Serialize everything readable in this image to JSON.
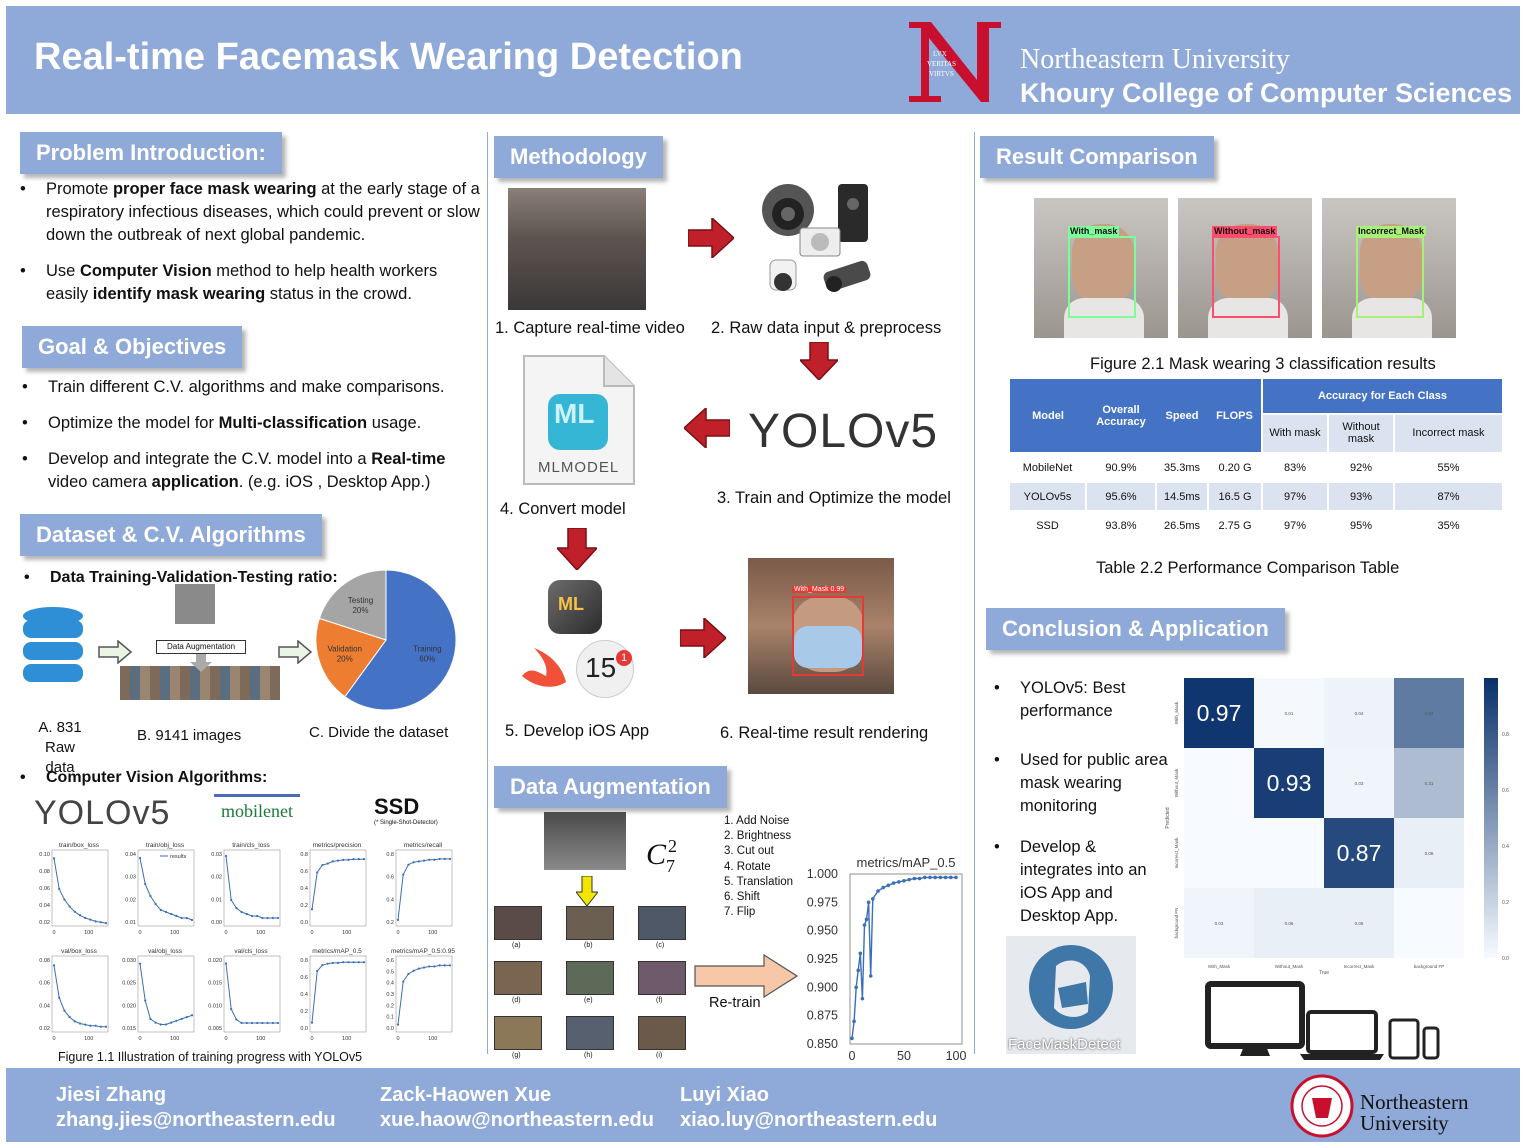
{
  "header": {
    "title": "Real-time Facemask Wearing Detection",
    "seal_text": "LVX VERITAS VIRTVS",
    "univ": "Northeastern University",
    "college": "Khoury College of Computer Sciences"
  },
  "problem": {
    "heading": "Problem Introduction:",
    "b1_pre": "Promote ",
    "b1_bold": "proper face mask wearing",
    "b1_post": " at the early stage of a respiratory infectious diseases, which could prevent or slow down the outbreak of next global pandemic.",
    "b2_pre": "Use ",
    "b2_bold": "Computer Vision",
    "b2_mid": " method to help health workers easily ",
    "b2_bold2": "identify mask wearing",
    "b2_post": " status in the crowd."
  },
  "goal": {
    "heading": "Goal & Objectives",
    "b1": "Train different C.V. algorithms and make comparisons.",
    "b2_pre": "Optimize the model for ",
    "b2_bold": "Multi-classification",
    "b2_post": " usage.",
    "b3_pre": "Develop and integrate the C.V. model into a ",
    "b3_bold": "Real-time",
    "b3_mid": " video camera ",
    "b3_bold2": "application",
    "b3_post": ". (e.g. iOS , Desktop App.)"
  },
  "dataset": {
    "heading": "Dataset & C.V. Algorithms",
    "ratio_label": "Data Training-Validation-Testing ratio:",
    "aug_label": "Data Augmentation",
    "a_label": "A. 831",
    "a_label2": "Raw data",
    "b_label": "B. 9141 images",
    "c_label": "C. Divide the dataset",
    "cv_label": "Computer Vision Algorithms:",
    "yolo": "YOLOv5",
    "mobilenet": "mobilenet",
    "ssd": "SSD",
    "ssd_note": "(* Single-Shot-Detector)",
    "fig_caption": "Figure 1.1 Illustration of training progress with YOLOv5",
    "legend_results": "results"
  },
  "pie": {
    "type": "pie",
    "slices": [
      {
        "label": "Training",
        "pct": "60%",
        "value": 60,
        "color": "#4472c4"
      },
      {
        "label": "Validation",
        "pct": "20%",
        "value": 20,
        "color": "#ed7d31"
      },
      {
        "label": "Testing",
        "pct": "20%",
        "value": 20,
        "color": "#a5a5a5"
      }
    ]
  },
  "methodology": {
    "heading": "Methodology",
    "s1": "1. Capture real-time video",
    "s2": "2. Raw data input & preprocess",
    "s3": "3. Train and Optimize the model",
    "s4": "4. Convert model",
    "s5": "5. Develop iOS App",
    "s6": "6. Real-time result rendering",
    "mlmodel": "MLMODEL",
    "ml_icon": "ML",
    "yolo_logo": "YOLOv5",
    "ios_version": "15",
    "badge": "1",
    "det_label": "With_Mask 0.99"
  },
  "augmentation": {
    "heading": "Data Augmentation",
    "combo_base": "C",
    "combo_sup": "2",
    "combo_sub": "7",
    "list": [
      "1. Add Noise",
      "2. Brightness",
      "3. Cut out",
      "4. Rotate",
      "5. Translation",
      "6. Shift",
      "7. Flip"
    ],
    "retrain": "Re-train",
    "tile_labels": [
      "(a)",
      "(b)",
      "(c)",
      "(d)",
      "(e)",
      "(f)",
      "(g)",
      "(h)",
      "(i)"
    ]
  },
  "map_chart": {
    "type": "line",
    "title": "metrics/mAP_0.5",
    "xlim": [
      0,
      100
    ],
    "ylim": [
      0.85,
      1.0
    ],
    "yticks": [
      "1.000",
      "0.975",
      "0.950",
      "0.925",
      "0.900",
      "0.875",
      "0.850"
    ],
    "xticks": [
      "0",
      "50",
      "100"
    ],
    "x": [
      0,
      2,
      4,
      6,
      8,
      10,
      12,
      14,
      16,
      18,
      20,
      25,
      30,
      35,
      40,
      45,
      50,
      55,
      60,
      65,
      70,
      75,
      80,
      85,
      90,
      95,
      100
    ],
    "y": [
      0.855,
      0.87,
      0.9,
      0.915,
      0.93,
      0.89,
      0.955,
      0.96,
      0.975,
      0.91,
      0.978,
      0.985,
      0.988,
      0.99,
      0.992,
      0.993,
      0.994,
      0.995,
      0.996,
      0.996,
      0.997,
      0.997,
      0.997,
      0.997,
      0.997,
      0.997,
      0.997
    ]
  },
  "mini_charts": [
    {
      "title": "train/box_loss",
      "yticks": [
        "0.10",
        "0.08",
        "0.06",
        "0.04",
        "0.02"
      ],
      "ymax": 0.1,
      "ymin": 0.02,
      "values": [
        0.095,
        0.06,
        0.048,
        0.04,
        0.034,
        0.03,
        0.027,
        0.025,
        0.023,
        0.022,
        0.021
      ]
    },
    {
      "title": "train/obj_loss",
      "yticks": [
        "0.04",
        "0.03",
        "0.02",
        "0.01"
      ],
      "ymax": 0.045,
      "ymin": 0.01,
      "values": [
        0.043,
        0.03,
        0.024,
        0.02,
        0.017,
        0.016,
        0.015,
        0.014,
        0.013,
        0.013,
        0.012
      ]
    },
    {
      "title": "train/cls_loss",
      "yticks": [
        "0.03",
        "0.02",
        "0.01",
        "0.00"
      ],
      "ymax": 0.035,
      "ymin": 0.0,
      "values": [
        0.034,
        0.012,
        0.008,
        0.006,
        0.005,
        0.004,
        0.004,
        0.003,
        0.003,
        0.003,
        0.003
      ]
    },
    {
      "title": "metrics/precision",
      "yticks": [
        "0.8",
        "0.6",
        "0.4",
        "0.2",
        "0.0"
      ],
      "ymax": 0.95,
      "ymin": 0.0,
      "values": [
        0.2,
        0.7,
        0.8,
        0.82,
        0.85,
        0.86,
        0.87,
        0.87,
        0.88,
        0.88,
        0.88
      ]
    },
    {
      "title": "metrics/recall",
      "yticks": [
        "0.8",
        "0.6",
        "0.4",
        "0.2"
      ],
      "ymax": 0.95,
      "ymin": 0.1,
      "values": [
        0.15,
        0.7,
        0.82,
        0.85,
        0.86,
        0.87,
        0.88,
        0.88,
        0.89,
        0.89,
        0.89
      ]
    },
    {
      "title": "val/box_loss",
      "yticks": [
        "0.08",
        "0.06",
        "0.04",
        "0.02"
      ],
      "ymax": 0.085,
      "ymin": 0.02,
      "values": [
        0.08,
        0.05,
        0.038,
        0.032,
        0.028,
        0.026,
        0.025,
        0.024,
        0.024,
        0.023,
        0.023
      ]
    },
    {
      "title": "val/obj_loss",
      "yticks": [
        "0.030",
        "0.025",
        "0.020",
        "0.015"
      ],
      "ymax": 0.031,
      "ymin": 0.012,
      "values": [
        0.03,
        0.02,
        0.015,
        0.014,
        0.0135,
        0.0135,
        0.014,
        0.0145,
        0.015,
        0.0155,
        0.016
      ]
    },
    {
      "title": "val/cls_loss",
      "yticks": [
        "0.020",
        "0.015",
        "0.010",
        "0.005"
      ],
      "ymax": 0.022,
      "ymin": 0.002,
      "values": [
        0.021,
        0.008,
        0.005,
        0.004,
        0.004,
        0.004,
        0.004,
        0.004,
        0.004,
        0.004,
        0.004
      ]
    },
    {
      "title": "metrics/mAP_0.5",
      "yticks": [
        "0.8",
        "0.6",
        "0.4",
        "0.2",
        "0.0"
      ],
      "ymax": 0.95,
      "ymin": 0.0,
      "values": [
        0.1,
        0.8,
        0.88,
        0.9,
        0.91,
        0.91,
        0.92,
        0.92,
        0.92,
        0.92,
        0.92
      ]
    },
    {
      "title": "metrics/mAP_0.5:0.95",
      "yticks": [
        "0.6",
        "0.5",
        "0.4",
        "0.3",
        "0.2",
        "0.1",
        "0.0"
      ],
      "ymax": 0.65,
      "ymin": 0.0,
      "values": [
        0.05,
        0.45,
        0.52,
        0.55,
        0.57,
        0.58,
        0.59,
        0.59,
        0.6,
        0.6,
        0.6
      ]
    }
  ],
  "mini_xticks": [
    "0",
    "100"
  ],
  "results": {
    "heading": "Result Comparison",
    "fig_caption": "Figure 2.1 Mask wearing 3 classification results",
    "labels": [
      "With_mask",
      "Without_mask",
      "Incorrect_Mask"
    ],
    "label_colors": [
      "#7CFC9A",
      "#ff4d6d",
      "#a8f07a"
    ],
    "table_caption": "Table 2.2 Performance Comparison Table",
    "table_head": {
      "model": "Model",
      "overall": "Overall Accuracy",
      "speed": "Speed",
      "flops": "FLOPS",
      "each": "Accuracy for Each Class",
      "c1": "With mask",
      "c2": "Without mask",
      "c3": "Incorrect mask"
    },
    "rows": [
      [
        "MobileNet",
        "90.9%",
        "35.3ms",
        "0.20 G",
        "83%",
        "92%",
        "55%"
      ],
      [
        "YOLOv5s",
        "95.6%",
        "14.5ms",
        "16.5 G",
        "97%",
        "93%",
        "87%"
      ],
      [
        "SSD",
        "93.8%",
        "26.5ms",
        "2.75 G",
        "97%",
        "95%",
        "35%"
      ]
    ]
  },
  "conclusion": {
    "heading": "Conclusion & Application",
    "b1": "YOLOv5: Best performance",
    "b2": "Used for public area mask wearing monitoring",
    "b3": "Develop & integrates into an iOS App and Desktop App.",
    "app_name": "FaceMaskDetect"
  },
  "heatmap": {
    "type": "heatmap",
    "cols": [
      "With_Mask",
      "Without_Mask",
      "Incorrect_Mask",
      "background FP"
    ],
    "rows": [
      "With_Mask",
      "Without_Mask",
      "Incorrect_Mask",
      "background FN"
    ],
    "xlabel": "True",
    "ylabel": "Predicted",
    "values": [
      [
        0.97,
        0.01,
        0.04,
        0.63
      ],
      [
        0.0,
        0.93,
        0.03,
        0.31
      ],
      [
        0.0,
        0.0,
        0.87,
        0.06
      ],
      [
        0.03,
        0.06,
        0.06,
        0.0
      ]
    ],
    "big_labels": [
      "0.97",
      "0.93",
      "0.87"
    ],
    "small_labels": [
      [
        "",
        "0.01",
        "0.04",
        "0.63"
      ],
      [
        "",
        "",
        "0.03",
        "0.31"
      ],
      [
        "",
        "",
        "",
        "0.06"
      ],
      [
        "0.03",
        "0.06",
        "0.06",
        ""
      ]
    ],
    "cbar_ticks": [
      "0.8",
      "0.6",
      "0.4",
      "0.2",
      "0.0"
    ]
  },
  "footer": {
    "a1_name": "Jiesi Zhang",
    "a1_email": "zhang.jies@northeastern.edu",
    "a2_name": "Zack-Haowen Xue",
    "a2_email": "xue.haow@northeastern.edu",
    "a3_name": "Luyi Xiao",
    "a3_email": "xiao.luy@northeastern.edu",
    "univ_line1": "Northeastern",
    "univ_line2": "University",
    "seal_ring": "NORTHEASTERN UNIVERSITY"
  },
  "colors": {
    "banner": "#8fa9d8",
    "accent_red": "#c8102e",
    "table_blue": "#4472c4",
    "table_row": "#dbe3f1",
    "arrow_red": "#c0202a"
  }
}
